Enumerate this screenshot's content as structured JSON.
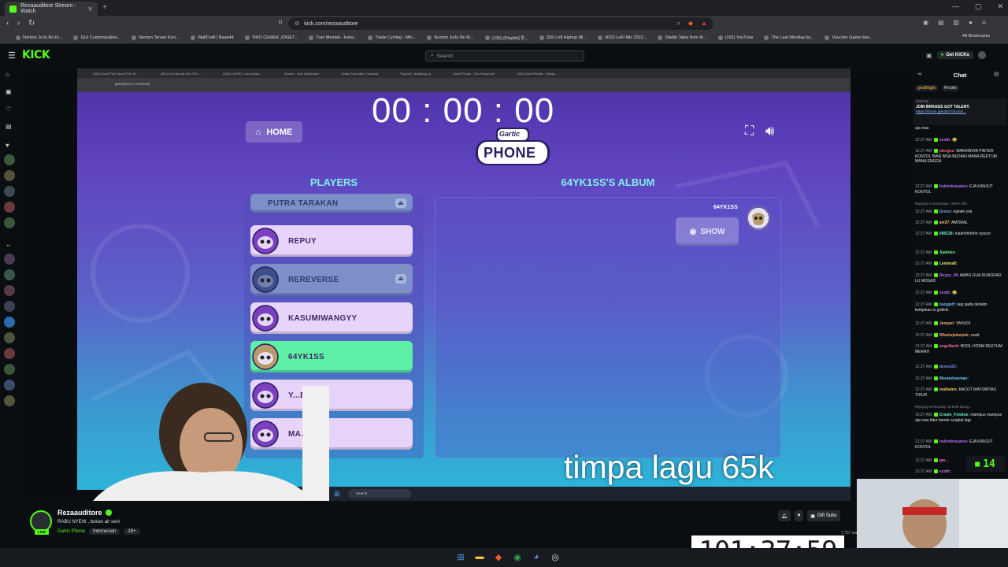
{
  "browser": {
    "tab_title": "Rezaauditore Stream - Watch",
    "url": "kick.com/rezaauditore",
    "bookmarks": [
      "Nonton JoJo No Ki...",
      "GUI Customization...",
      "Nonton Tensei Kizo...",
      "WallCraft | Base44",
      "TRIO CEWEK JOGET...",
      "Tuer Memek - Insta...",
      "Trade Cycling - Min...",
      "Nonton JoJo No Ki...",
      "(236) [Playlist] 듣...",
      "(53) Lofi Hiphop Mi...",
      "(422) LoFi Mix 2022...",
      "Diablo Tales from th...",
      "(192) YouTube",
      "The Last Monday by...",
      "Voucher Game dan..."
    ],
    "all_bookmarks": "All Bookmarks"
  },
  "kick": {
    "logo": "KICK",
    "search_placeholder": "Search",
    "get_kicks": "Get KICKs"
  },
  "game": {
    "inner_url": "garticphone.com/book",
    "inner_tabs": [
      "(452) Dead Pool Stuck Peel St...",
      "(452) Lofi Hiphop Mix 2022...",
      "(452) LAGRIO Jazz Music...",
      "Stream - Kick Dashboard",
      "Daftar Transaksi | Saweria",
      "Support | BagiBagi.co",
      "Gartic Phone - The Telephone",
      "(452) Dewi Felicita - Dengu..."
    ],
    "timer": "00 : 00 : 00",
    "home_label": "HOME",
    "logo_top": "Gartic",
    "logo_bottom": "PHONE",
    "players_title": "PLAYERS",
    "album_title": "64YK1SS'S ALBUM",
    "players": [
      {
        "name": "PUTRA TARAKAN",
        "state": "dim"
      },
      {
        "name": "REPUY",
        "state": "normal"
      },
      {
        "name": "REREVERSE",
        "state": "dim"
      },
      {
        "name": "KASUMIWANGYY",
        "state": "normal"
      },
      {
        "name": "64YK1SS",
        "state": "active"
      },
      {
        "name": "Y...E",
        "state": "normal"
      },
      {
        "name": "MA...",
        "state": "normal"
      }
    ],
    "album_user": "64YK1SS",
    "show_label": "SHOW",
    "overlay_text": "timpa lagu 65k",
    "inner_search": "Search"
  },
  "chat": {
    "title": "Chat",
    "pinned_chips": [
      "goodNight",
      "Pinckle"
    ],
    "pinned_sender": "Sent by",
    "pinned_text": "JOIN BRRADS GOT TALENT:",
    "pinned_link": "https://forms.gle/dezY5UmD...",
    "messages": [
      {
        "time": "",
        "user": "",
        "color": "#bbbbbb",
        "text": "aja mas"
      },
      {
        "time": "12:27 AM",
        "user": "sxxth:",
        "color": "#d16cf5",
        "text": "😂"
      },
      {
        "time": "12:27 AM",
        "user": "ptergos:",
        "color": "#f56c6c",
        "text": "MAKANNYA PINTER KONTOL BIAR BISA BEDAIN MANA REKTUM MANA ENGGA"
      },
      {
        "time": "12:27 AM",
        "user": "bukiminayatsu:",
        "color": "#b06cf5",
        "text": "EJA KANJUT KONTOL"
      },
      {
        "time": "",
        "user": "",
        "color": "#8a8f96",
        "text": "Replying to xeeosoaya: UDAH CEK..."
      },
      {
        "time": "12:27 AM",
        "user": "Grouz:",
        "color": "#6cb4f5",
        "text": "ngewe yok"
      },
      {
        "time": "12:27 AM",
        "user": "arr27:",
        "color": "#f5d06c",
        "text": "AMORAL"
      },
      {
        "time": "12:27 AM",
        "user": "000136:",
        "color": "#6cf5e0",
        "text": "halahhhhhhh nyocot"
      },
      {
        "time": "12:27 AM",
        "user": "Ajalinke:",
        "color": "#6cf58f",
        "text": ""
      },
      {
        "time": "12:27 AM",
        "user": "Lentera8:",
        "color": "#f5e06c",
        "text": ""
      },
      {
        "time": "12:27 AM",
        "user": "Reyyy_28:",
        "color": "#b46cf5",
        "text": "AWAS GUA RUNGKAD LU MOSAD"
      },
      {
        "time": "12:27 AM",
        "user": "sxxth:",
        "color": "#d16cf5",
        "text": "😂"
      },
      {
        "time": "12:27 AM",
        "user": "bangjeff:",
        "color": "#6cb4f5",
        "text": "lagi pada debatin kebijakan lu goblok"
      },
      {
        "time": "12:27 AM",
        "user": "Jerquel:",
        "color": "#f5b46c",
        "text": "YAHUDI"
      },
      {
        "time": "12:27 AM",
        "user": "Wkwiwjwkwjwk:",
        "color": "#f5a06c",
        "text": "rusdi"
      },
      {
        "time": "12:27 AM",
        "user": "angelfarid:",
        "color": "#f56c9a",
        "text": "BOOL HITAM REKTUM MERAH"
      },
      {
        "time": "12:27 AM",
        "user": "denon33:",
        "color": "#6c8ff5",
        "text": ""
      },
      {
        "time": "12:27 AM",
        "user": "Msrandomman:",
        "color": "#6cc8f5",
        "text": ""
      },
      {
        "time": "12:27 AM",
        "user": "mafisims:",
        "color": "#f5cc6c",
        "text": "BACOT MAYORITAS TIDUR"
      },
      {
        "time": "",
        "user": "",
        "color": "#8a8f96",
        "text": "Replying to Riezzkay: itu ketik kirang..."
      },
      {
        "time": "12:27 AM",
        "user": "Cream_Fondue:",
        "color": "#6cf5c8",
        "text": "mampus mampus aja mas tidur besok rungkat lagi"
      },
      {
        "time": "12:27 AM",
        "user": "bukiminayatsu:",
        "color": "#b06cf5",
        "text": "EJA KANJUT KONTOL"
      },
      {
        "time": "12:27 AM",
        "user": "gw...",
        "color": "#f56cc8",
        "text": ""
      },
      {
        "time": "12:27 AM",
        "user": "sxxth:",
        "color": "#d16cf5",
        "text": ""
      }
    ],
    "kick_count": "14"
  },
  "channel": {
    "name": "Rezaauditore",
    "live": "LIVE",
    "title": "RABU NYENI , bukan air seni",
    "category": "Gartic Phone",
    "tags": [
      "Indonesian",
      "18+"
    ],
    "gift_subs": "Gift Subs",
    "viewers": "7,757 watching"
  },
  "overlay": {
    "counter": "101:37:59"
  }
}
